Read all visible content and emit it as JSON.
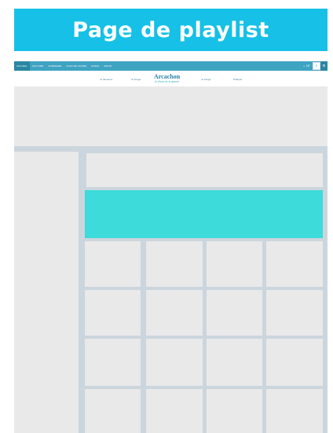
{
  "banner": {
    "title": "Page de playlist"
  },
  "site": {
    "topnav": [
      "Accueil",
      "Culture",
      "Sommaire",
      "Plan de cours",
      "Radio",
      "Infos"
    ],
    "tools": {
      "weather": "☼ 18°",
      "search_icon": "search-icon",
      "menu_icon": "menu-icon"
    },
    "subnav": [
      "Je découvre",
      "Je bouge",
      "Je bouge",
      "Pratique"
    ],
    "logo": {
      "name": "Arcachon",
      "tagline": "à vivre et à aimer"
    }
  },
  "colors": {
    "banner_bg": "#16c0e6",
    "topbar_bg": "#3fa3c2",
    "frame_bg": "#cbd5dd",
    "placeholder_bg": "#e9e9e9",
    "player_bg": "#3ddbd9"
  },
  "grid": {
    "rows": 4,
    "cols": 4
  }
}
